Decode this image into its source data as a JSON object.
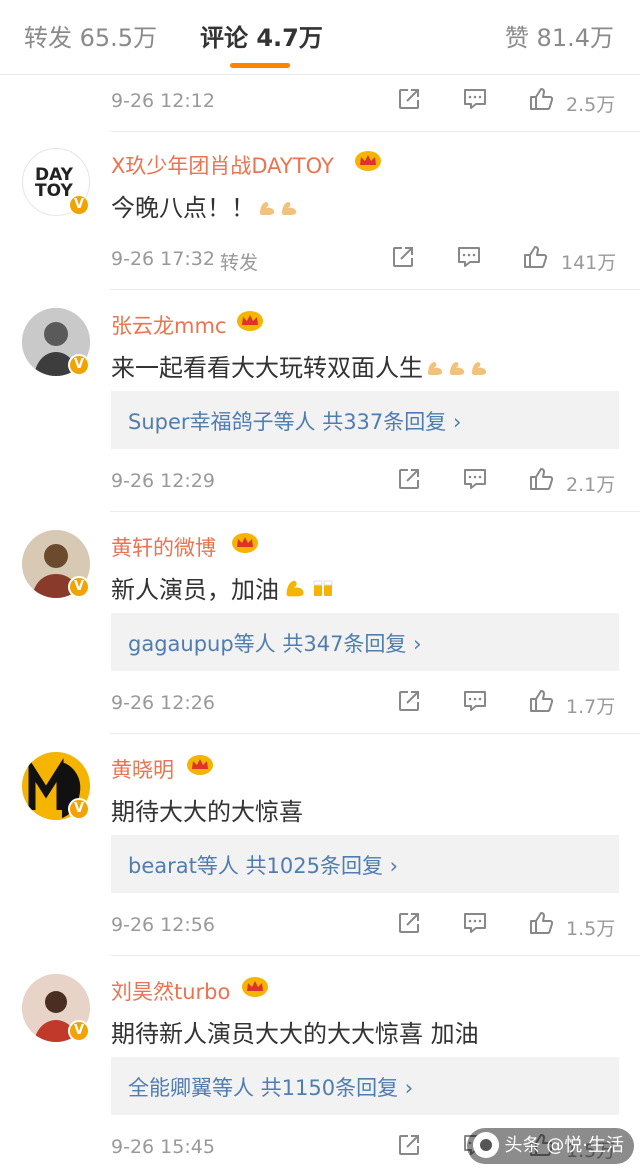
{
  "tabs": {
    "repost": "转发 65.5万",
    "comments": "评论 4.7万",
    "likes": "赞 81.4万"
  },
  "colors": {
    "accent": "#ff8200",
    "username": "#eb7350",
    "reply_link": "#507daf",
    "verified_badge": "#f2a300"
  },
  "icons": {
    "share": "share-icon",
    "comment": "comment-icon",
    "like": "thumbs-up-icon",
    "crown": "crown-icon",
    "verified": "verified-badge-icon"
  },
  "top_meta": {
    "time": "9-26 12:12",
    "likes": "2.5万"
  },
  "comments": [
    {
      "user": "X玖少年团肖战DAYTOY",
      "text": "今晚八点！！",
      "emoji": [
        "muscle",
        "muscle"
      ],
      "time": "9-26 17:32",
      "forward_label": "转发",
      "likes": "141万",
      "avatar_text": "DAY TOY"
    },
    {
      "user": "张云龙mmc",
      "text": "来一起看看大大玩转双面人生",
      "emoji": [
        "muscle",
        "muscle",
        "muscle"
      ],
      "reply": "Super幸福鸽子等人  共337条回复 ›",
      "time": "9-26 12:29",
      "likes": "2.1万"
    },
    {
      "user": "黄轩的微博",
      "text": "新人演员，加油",
      "emoji": [
        "muscle-yellow",
        "beer"
      ],
      "reply": "gagaupup等人  共347条回复 ›",
      "time": "9-26 12:26",
      "likes": "1.7万"
    },
    {
      "user": "黄晓明",
      "text": "期待大大的大惊喜",
      "emoji": [],
      "reply": "bearat等人  共1025条回复 ›",
      "time": "9-26 12:56",
      "likes": "1.5万"
    },
    {
      "user": "刘昊然turbo",
      "text": "期待新人演员大大的大大惊喜 加油",
      "emoji": [],
      "reply": "全能卿翼等人  共1150条回复 ›",
      "time": "9-26 15:45",
      "likes": "1.5万"
    }
  ],
  "watermark": "头条 @悦·生活"
}
